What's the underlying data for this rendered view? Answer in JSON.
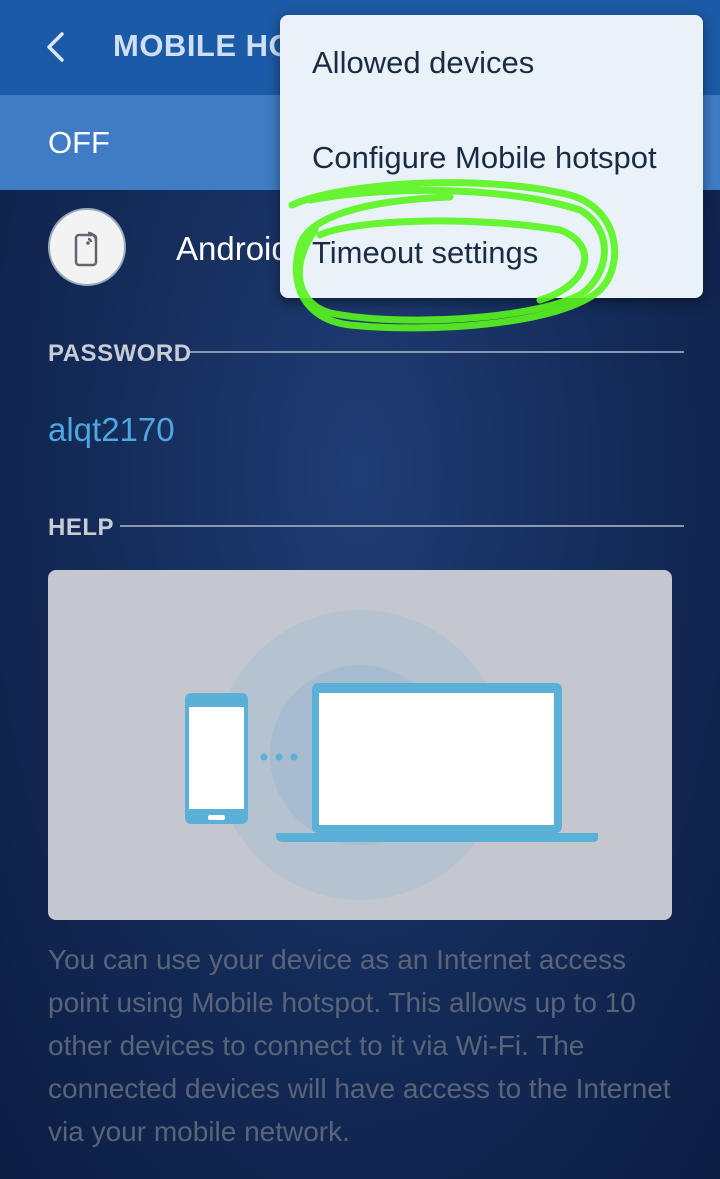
{
  "header": {
    "title": "MOBILE HOTSPOT",
    "back_icon": "chevron-left-icon"
  },
  "switch": {
    "label": "OFF"
  },
  "device": {
    "icon": "phone-broadcast-icon",
    "name": "AndroidHotspot"
  },
  "password": {
    "heading": "PASSWORD",
    "value": "alqt2170"
  },
  "help": {
    "heading": "HELP",
    "illustration": "phone-to-laptop-hotspot-illustration",
    "text": "You can use your device as an Internet access point using Mobile hotspot. This allows up to 10 other devices to connect to it via Wi-Fi. The connected devices will have access to the Internet via your mobile network."
  },
  "overflow_menu": {
    "items": [
      {
        "label": "Allowed devices"
      },
      {
        "label": "Configure Mobile hotspot"
      },
      {
        "label": "Timeout settings"
      }
    ]
  },
  "colors": {
    "appbar": "#1b5aa6",
    "switchbar": "#3f7cc4",
    "accent": "#4fa7df",
    "menu_bg": "#e9f1f9",
    "highlight": "#5af51e"
  }
}
